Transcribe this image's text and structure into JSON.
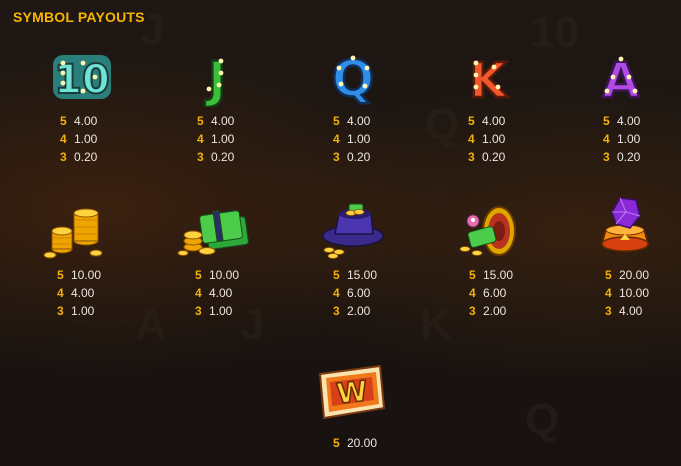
{
  "title": "SYMBOL PAYOUTS",
  "symbols": [
    {
      "icon": "ten-symbol-icon",
      "glyph": "10",
      "color": "#4fd0c6",
      "payouts": [
        {
          "count": "5",
          "value": "4.00"
        },
        {
          "count": "4",
          "value": "1.00"
        },
        {
          "count": "3",
          "value": "0.20"
        }
      ]
    },
    {
      "icon": "jack-symbol-icon",
      "glyph": "J",
      "color": "#3bbf3b",
      "payouts": [
        {
          "count": "5",
          "value": "4.00"
        },
        {
          "count": "4",
          "value": "1.00"
        },
        {
          "count": "3",
          "value": "0.20"
        }
      ]
    },
    {
      "icon": "queen-symbol-icon",
      "glyph": "Q",
      "color": "#2f8fe8",
      "payouts": [
        {
          "count": "5",
          "value": "4.00"
        },
        {
          "count": "4",
          "value": "1.00"
        },
        {
          "count": "3",
          "value": "0.20"
        }
      ]
    },
    {
      "icon": "king-symbol-icon",
      "glyph": "K",
      "color": "#f2562a",
      "payouts": [
        {
          "count": "5",
          "value": "4.00"
        },
        {
          "count": "4",
          "value": "1.00"
        },
        {
          "count": "3",
          "value": "0.20"
        }
      ]
    },
    {
      "icon": "ace-symbol-icon",
      "glyph": "A",
      "color": "#b24be6",
      "payouts": [
        {
          "count": "5",
          "value": "4.00"
        },
        {
          "count": "4",
          "value": "1.00"
        },
        {
          "count": "3",
          "value": "0.20"
        }
      ]
    },
    {
      "icon": "gold-coins-icon",
      "payouts": [
        {
          "count": "5",
          "value": "10.00"
        },
        {
          "count": "4",
          "value": "4.00"
        },
        {
          "count": "3",
          "value": "1.00"
        }
      ]
    },
    {
      "icon": "cash-stack-icon",
      "payouts": [
        {
          "count": "5",
          "value": "10.00"
        },
        {
          "count": "4",
          "value": "4.00"
        },
        {
          "count": "3",
          "value": "1.00"
        }
      ]
    },
    {
      "icon": "magic-hat-icon",
      "payouts": [
        {
          "count": "5",
          "value": "15.00"
        },
        {
          "count": "4",
          "value": "6.00"
        },
        {
          "count": "3",
          "value": "2.00"
        }
      ]
    },
    {
      "icon": "drum-icon",
      "payouts": [
        {
          "count": "5",
          "value": "15.00"
        },
        {
          "count": "4",
          "value": "6.00"
        },
        {
          "count": "3",
          "value": "2.00"
        }
      ]
    },
    {
      "icon": "gem-pedestal-icon",
      "payouts": [
        {
          "count": "5",
          "value": "20.00"
        },
        {
          "count": "4",
          "value": "10.00"
        },
        {
          "count": "3",
          "value": "4.00"
        }
      ]
    },
    {
      "icon": "wild-symbol-icon",
      "glyph": "W",
      "payouts": [
        {
          "count": "5",
          "value": "20.00"
        }
      ]
    }
  ]
}
